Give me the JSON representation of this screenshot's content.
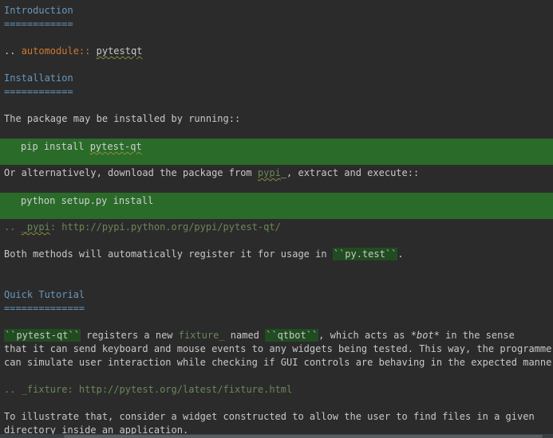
{
  "intro": {
    "title": "Introduction",
    "underline": "============",
    "directive_prefix": ".. ",
    "directive_name": "automodule::",
    "directive_arg": "pytestqt"
  },
  "install": {
    "title": "Installation",
    "underline": "============",
    "para1": "The package may be installed by running::",
    "code1_prefix": "pip install ",
    "code1_pkg": "pytest-qt",
    "para2_before": "Or alternatively, download the package from ",
    "para2_link": "pypi",
    "para2_after": "_, extract and execute::",
    "code2": "python setup.py install",
    "target_prefix": ".. ",
    "target_name": "_pypi",
    "target_url": ": http://pypi.python.org/pypi/pytest-qt/",
    "para3_before": "Both methods will automatically register it for usage in ",
    "para3_literal": "``py.test``",
    "para3_after": "."
  },
  "tutorial": {
    "title": "Quick Tutorial",
    "underline": "==============",
    "line1_literal1": "``pytest-qt``",
    "line1_mid1": " registers a new ",
    "line1_ref": "fixture_",
    "line1_mid2": " named ",
    "line1_literal2": "``qtbot``",
    "line1_mid3": ", which acts as ",
    "line1_em": "*bot*",
    "line1_end": " in the sense",
    "line2": "that it can send keyboard and mouse events to any widgets being tested. This way, the programmer",
    "line3": "can simulate user interaction while checking if GUI controls are behaving in the expected manner.",
    "target_prefix": ".. ",
    "target_name": "_fixture",
    "target_url": ": http://pytest.org/latest/fixture.html",
    "para_line1": "To illustrate that, consider a widget constructed to allow the user to find files in a given",
    "para_line2": "directory inside an application."
  },
  "colors": {
    "background": "#2b2b2b",
    "heading": "#6897bb",
    "directive": "#cc7832",
    "code_block": "#2a6b2a",
    "inline_literal": "#214c21"
  }
}
